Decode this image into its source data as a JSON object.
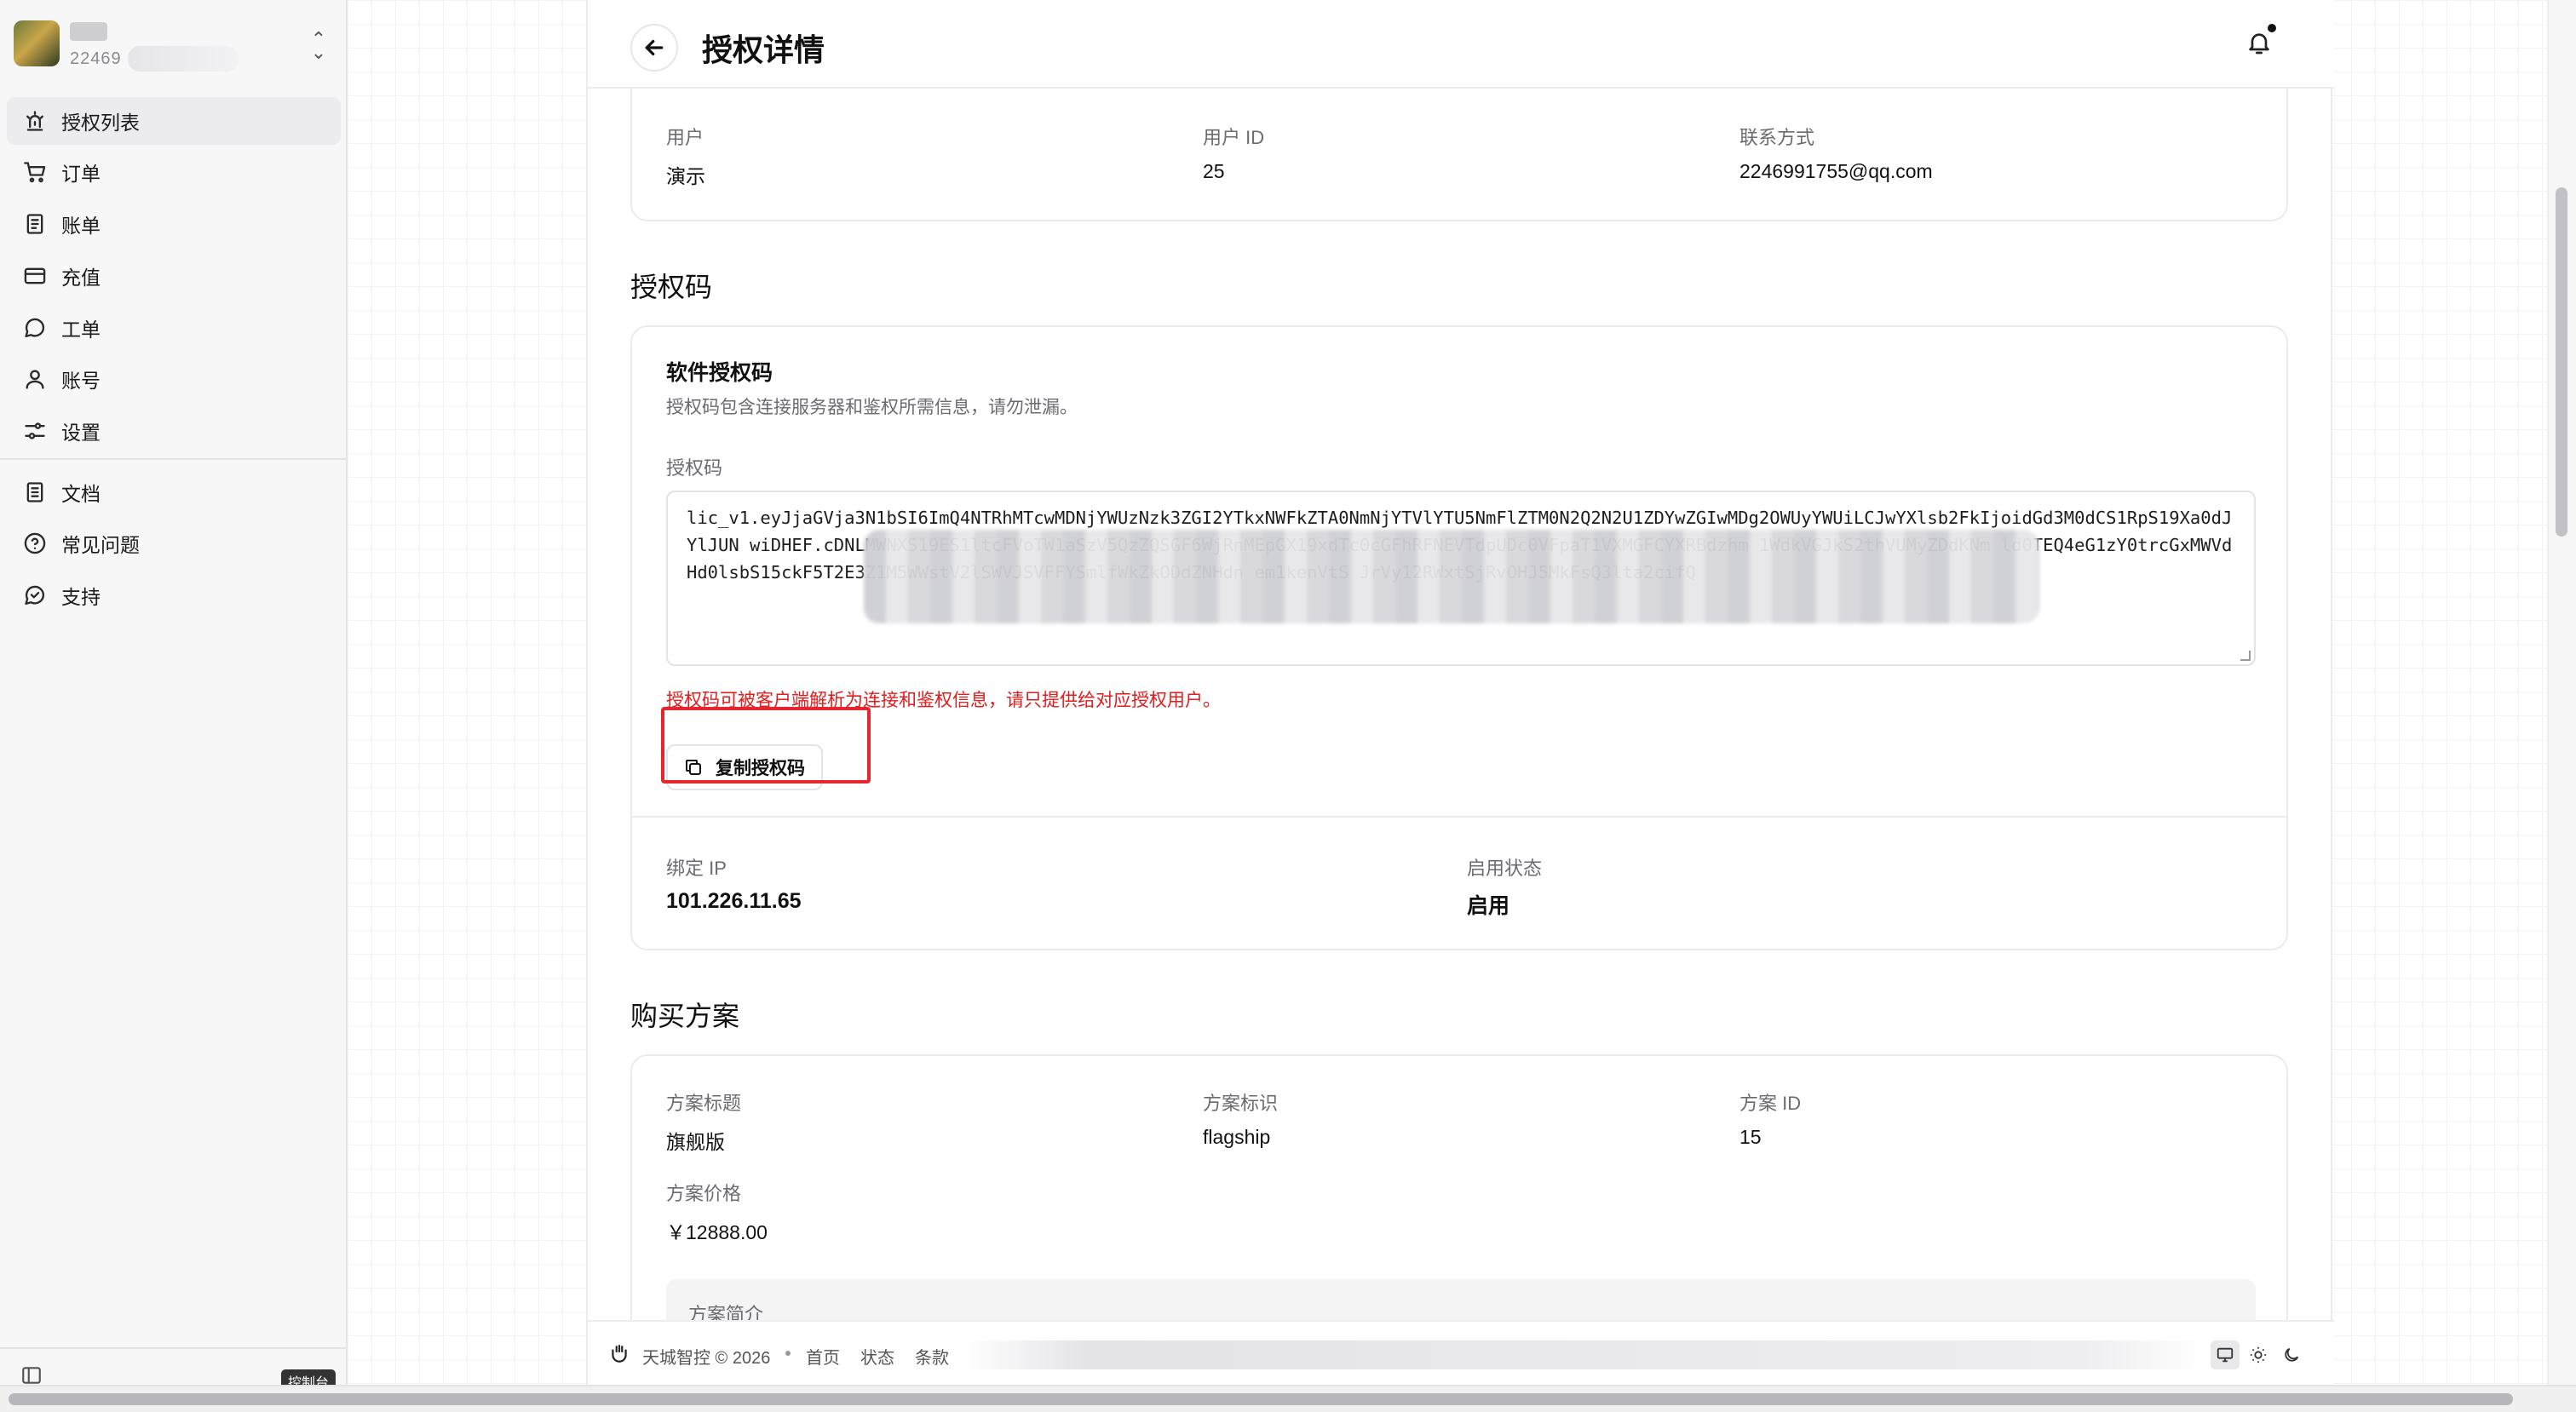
{
  "sidebar": {
    "user_id": "22469",
    "items": [
      {
        "label": "授权列表",
        "icon": "siren-icon",
        "active": true
      },
      {
        "label": "订单",
        "icon": "cart-icon"
      },
      {
        "label": "账单",
        "icon": "receipt-icon"
      },
      {
        "label": "充值",
        "icon": "credit-card-icon"
      },
      {
        "label": "工单",
        "icon": "message-circle-icon"
      },
      {
        "label": "账号",
        "icon": "user-icon"
      },
      {
        "label": "设置",
        "icon": "sliders-icon"
      }
    ],
    "secondary_items": [
      {
        "label": "文档",
        "icon": "document-icon"
      },
      {
        "label": "常见问题",
        "icon": "help-circle-icon"
      },
      {
        "label": "支持",
        "icon": "check-circle-icon"
      }
    ],
    "console_badge": "控制台"
  },
  "header": {
    "title": "授权详情"
  },
  "user_info": {
    "user_label": "用户",
    "user_value": "演示",
    "user_id_label": "用户 ID",
    "user_id_value": "25",
    "contact_label": "联系方式",
    "contact_value": "2246991755@qq.com"
  },
  "license_section": {
    "title": "授权码",
    "card_title": "软件授权码",
    "card_desc": "授权码包含连接服务器和鉴权所需信息，请勿泄漏。",
    "code_label": "授权码",
    "code_value": "lic_v1.eyJjaGVja3N1bSI6ImQ4NTRhMTcwMDNjYWUzNzk3ZGI2YTkxNWFkZTA0NmNjYTVlYTU5NmFlZTM0N2Q2N2U1ZDYwZGIwMDg2OWUyYWUiLCJwYXlsb2FkIjoidGd3M0dCS1RpS19Xa0dJYlJUN                                                                                                      wiDHEF.cDNLMWNXS19ES1ltcFVoTW1aSzV5QzZQSGF6WjRnMEpGX19xdTc0cGFhRFNEVTdpUDc0VFpaT1VXMGFCYXRBdzhm                        1WdkVGJkS2thVUMyZDdKNm                                                                  ld0TEQ4eG1zY0trcGxMWVdHd0lsbS15ckF5T2E3Z1M5WWstV2lSWVJSVFFYSmlfWkZkODdZNHdn                              em1kenVtS                                    JrVy12RWxtSjRvOHJ5MkFsQ3lta2cifQ",
    "warning": "授权码可被客户端解析为连接和鉴权信息，请只提供给对应授权用户。",
    "copy_button": "复制授权码",
    "bind_ip_label": "绑定 IP",
    "bind_ip_value": "101.226.11.65",
    "status_label": "启用状态",
    "status_value": "启用"
  },
  "plan_section": {
    "title": "购买方案",
    "plan_title_label": "方案标题",
    "plan_title_value": "旗舰版",
    "plan_key_label": "方案标识",
    "plan_key_value": "flagship",
    "plan_id_label": "方案 ID",
    "plan_id_value": "15",
    "price_label": "方案价格",
    "price_value": "￥12888.00",
    "intro_label": "方案简介"
  },
  "footer": {
    "copyright": "天城智控 © 2026",
    "links": [
      "首页",
      "状态",
      "条款"
    ]
  }
}
